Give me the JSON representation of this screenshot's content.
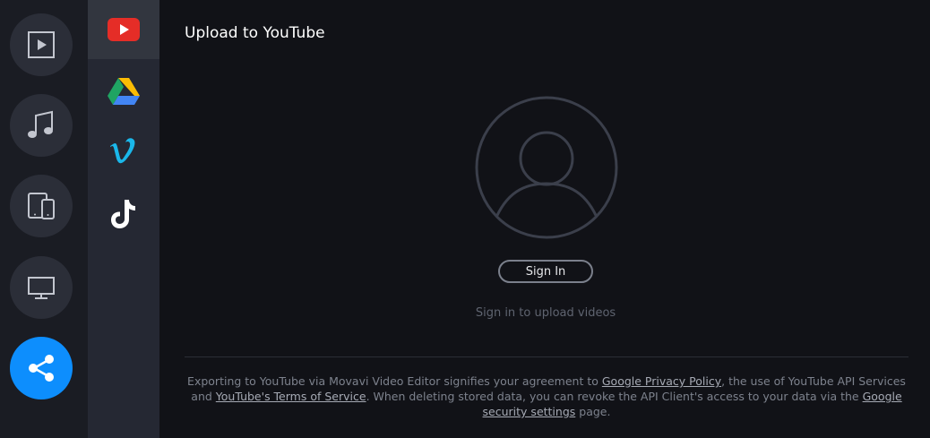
{
  "rail": {
    "items": [
      {
        "icon": "video-file-icon"
      },
      {
        "icon": "music-note-icon"
      },
      {
        "icon": "devices-icon"
      },
      {
        "icon": "monitor-icon"
      },
      {
        "icon": "share-icon",
        "active": true
      }
    ]
  },
  "services": {
    "items": [
      {
        "icon": "youtube-icon",
        "active": true
      },
      {
        "icon": "google-drive-icon"
      },
      {
        "icon": "vimeo-icon"
      },
      {
        "icon": "tiktok-icon"
      }
    ]
  },
  "main": {
    "title": "Upload to YouTube",
    "sign_in_label": "Sign In",
    "hint": "Sign in to upload videos",
    "legal": {
      "p1": "Exporting to YouTube via Movavi Video Editor signifies your agreement to ",
      "link1": "Google Privacy Policy",
      "p2": ", the use of YouTube API Services and ",
      "link2": "YouTube's Terms of Service",
      "p3": ". When deleting stored data, you can revoke the API Client's access to your data via the ",
      "link3": "Google security settings",
      "p4": " page."
    }
  },
  "colors": {
    "accent": "#0d8efd",
    "youtube_red": "#e52d27",
    "vimeo_blue": "#1ab7ea"
  }
}
